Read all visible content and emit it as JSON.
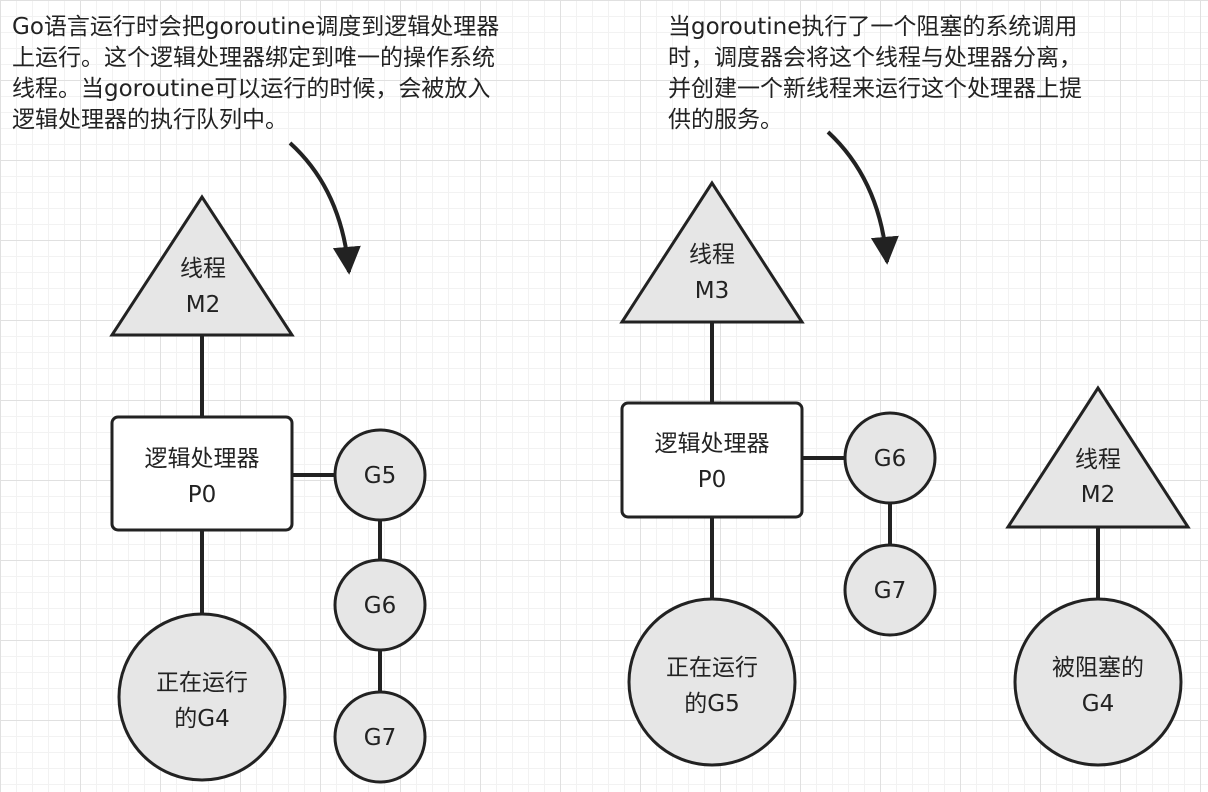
{
  "left_panel": {
    "caption": [
      "Go语言运行时会把goroutine调度到逻辑处理器",
      "上运行。这个逻辑处理器绑定到唯一的操作系统",
      "线程。当goroutine可以运行的时候，会被放入",
      "逻辑处理器的执行队列中。"
    ],
    "thread": {
      "line1": "线程",
      "line2": "M2"
    },
    "processor": {
      "line1": "逻辑处理器",
      "line2": "P0"
    },
    "running": {
      "line1": "正在运行",
      "line2": "的G4"
    },
    "queue": [
      "G5",
      "G6",
      "G7"
    ]
  },
  "right_panel": {
    "caption": [
      "当goroutine执行了一个阻塞的系统调用",
      "时，调度器会将这个线程与处理器分离，",
      "并创建一个新线程来运行这个处理器上提",
      "供的服务。"
    ],
    "thread": {
      "line1": "线程",
      "line2": "M3"
    },
    "processor": {
      "line1": "逻辑处理器",
      "line2": "P0"
    },
    "running": {
      "line1": "正在运行",
      "line2": "的G5"
    },
    "queue": [
      "G6",
      "G7"
    ],
    "blocked_thread": {
      "line1": "线程",
      "line2": "M2"
    },
    "blocked": {
      "line1": "被阻塞的",
      "line2": "G4"
    }
  },
  "colors": {
    "node_fill": "#e6e6e6",
    "stroke": "#222222",
    "box_fill": "#ffffff"
  }
}
